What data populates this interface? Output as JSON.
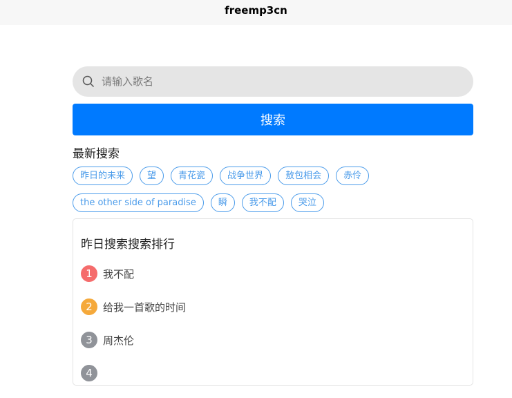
{
  "app": {
    "title": "freemp3cn"
  },
  "search": {
    "placeholder": "请输入歌名",
    "value": "",
    "button_label": "搜索"
  },
  "recent": {
    "title": "最新搜索",
    "rows": [
      [
        "昨日的未来",
        "望",
        "青花瓷",
        "战争世界",
        "敖包相会",
        "赤伶"
      ],
      [
        "the other side of paradise",
        "瞬",
        "我不配",
        "哭泣"
      ]
    ]
  },
  "ranking": {
    "title": "昨日搜索搜索排行",
    "items": [
      {
        "rank": "1",
        "name": "我不配",
        "color": "#f56c6c"
      },
      {
        "rank": "2",
        "name": "给我一首歌的时间",
        "color": "#f5a93b"
      },
      {
        "rank": "3",
        "name": "周杰伦",
        "color": "#909399"
      },
      {
        "rank": "4",
        "name": "",
        "color": "#909399"
      }
    ]
  },
  "colors": {
    "accent": "#007aff",
    "tag": "#4a9bea"
  }
}
